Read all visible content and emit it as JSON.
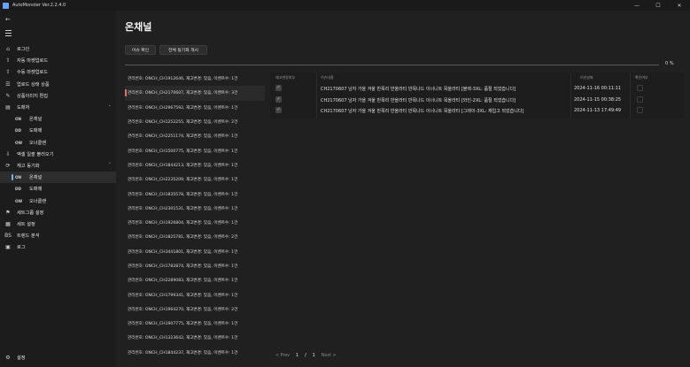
{
  "app": {
    "title": "AutoMonster Ver.2.2.4.0"
  },
  "window_controls": {
    "minimize": "—",
    "maximize": "☐",
    "close": "✕"
  },
  "sidebar": {
    "back": "←",
    "items": [
      {
        "icon": "⌂",
        "label": "로그인"
      },
      {
        "icon": "⇧",
        "label": "자동 마켓업로드"
      },
      {
        "icon": "⇧",
        "label": "수동 마켓업로드"
      },
      {
        "icon": "☰",
        "label": "업로드 상태 상품"
      },
      {
        "icon": "✎",
        "label": "상품이미지 편집"
      },
      {
        "icon": "▤",
        "label": "도매처",
        "chevron": "˄"
      },
      {
        "icon": "ON",
        "label": "온채널",
        "sub": true
      },
      {
        "icon": "DD",
        "label": "도매매",
        "sub": true
      },
      {
        "icon": "OW",
        "label": "오너클랜",
        "sub": true
      },
      {
        "icon": "⇩",
        "label": "엑셀 일괄 불러오기"
      },
      {
        "icon": "⟳",
        "label": "재고 동기화",
        "chevron": "˄"
      },
      {
        "icon": "ON",
        "label": "온채널",
        "sub": true,
        "active": true
      },
      {
        "icon": "DD",
        "label": "도매매",
        "sub": true
      },
      {
        "icon": "OW",
        "label": "오너클랜",
        "sub": true
      },
      {
        "icon": "⚑",
        "label": "세트그룹 설정"
      },
      {
        "icon": "▦",
        "label": "세트 설정"
      },
      {
        "icon": "BS",
        "label": "트렌드 분석"
      },
      {
        "icon": "▣",
        "label": "로그"
      }
    ],
    "settings": {
      "icon": "⚙",
      "label": "설정"
    }
  },
  "main": {
    "title": "온채널",
    "buttons": {
      "check_issue": "이슈 확인",
      "full_sync": "전체 동기화 개시"
    },
    "progress": {
      "value": 0,
      "label": "0 %"
    },
    "list": [
      "관리번호: ONCH_CH1912646, 재고변경: 있음, 이벤트수: 1건",
      "관리번호: ONCH_CH2170607, 재고변경: 있음, 이벤트수: 3건",
      "관리번호: ONCH_CH2967592, 재고변경: 있음, 이벤트수: 1건",
      "관리번호: ONCH_CH1252255, 재고변경: 있음, 이벤트수: 2건",
      "관리번호: ONCH_CH2251174, 재고변경: 있음, 이벤트수: 1건",
      "관리번호: ONCH_CH1500775, 재고변경: 있음, 이벤트수: 1건",
      "관리번호: ONCH_CH1844213, 재고변경: 있음, 이벤트수: 1건",
      "관리번호: ONCH_CH2235209, 재고변경: 있음, 이벤트수: 1건",
      "관리번호: ONCH_CH1835578, 재고변경: 있음, 이벤트수: 1건",
      "관리번호: ONCH_CH2301531, 재고변경: 있음, 이벤트수: 1건",
      "관리번호: ONCH_CH1926804, 재고변경: 있음, 이벤트수: 1건",
      "관리번호: ONCH_CH1825781, 재고변경: 있음, 이벤트수: 2건",
      "관리번호: ONCH_CH3441801, 재고변경: 있음, 이벤트수: 1건",
      "관리번호: ONCH_CH1782874, 재고변경: 있음, 이벤트수: 1건",
      "관리번호: ONCH_CH2289083, 재고변경: 있음, 이벤트수: 1건",
      "관리번호: ONCH_CH1799341, 재고변경: 있음, 이벤트수: 1건",
      "관리번호: ONCH_CH1964270, 재고변경: 있음, 이벤트수: 2건",
      "관리번호: ONCH_CH1907775, 재고변경: 있음, 이벤트수: 1건",
      "관리번호: ONCH_CH1323642, 재고변경: 있음, 이벤트수: 1건",
      "관리번호: ONCH_CH1844237, 재고변경: 있음, 이벤트수: 1건"
    ],
    "selected_index": 1,
    "pager": {
      "prev": "< Prev",
      "current": "1",
      "sep": "/",
      "total": "1",
      "next": "Next >"
    },
    "grid": {
      "headers": [
        "재고변경여부",
        "이슈내용",
        "이슈날짜",
        "확인여부"
      ],
      "rows": [
        {
          "checked": true,
          "content": "CH2170607 남자 가을 겨울 반폭리 반올라티 반목나드 이너니트 목올라티 [블랙-3XL: 품절 되었습니다]",
          "date": "2024-11-16 00:11:11"
        },
        {
          "checked": true,
          "content": "CH2170607 남자 가을 겨울 반폭리 반올라티 반목나드 이너니트 목올라티 [와인-2XL: 품절 되었습니다]",
          "date": "2024-11-15 00:38:25"
        },
        {
          "checked": true,
          "content": "CH2170607 남자 가을 겨울 반폭리 반올라티 반목나드 이너니트 목올라티 [그레이-3XL: 재입고 되었습니다]",
          "date": "2024-11-13 17:49:49"
        }
      ]
    }
  },
  "colors": {
    "accent": "#7fb0ff",
    "selected_marker": "#e07070",
    "background": "#202020"
  }
}
